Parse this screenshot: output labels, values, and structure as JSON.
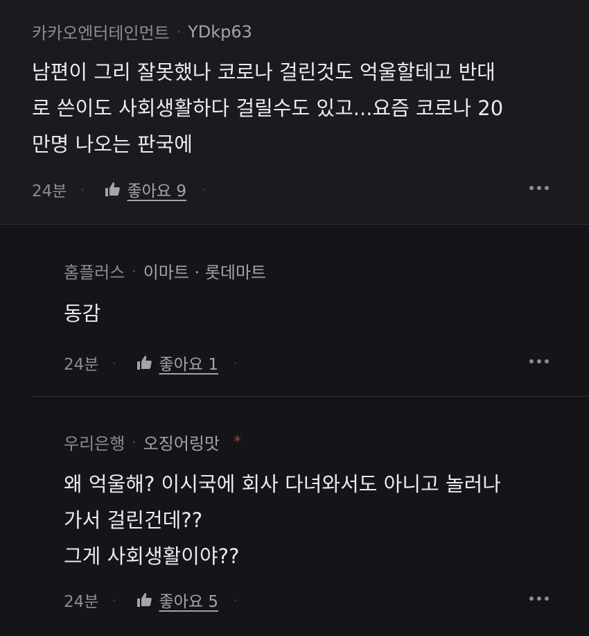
{
  "comments": [
    {
      "author_org": "카카오엔터테인먼트",
      "author_nick": "YDkp63",
      "body": "남편이 그리 잘못했나 코로나 걸린것도 억울할테고 반대\n로 쓴이도 사회생활하다 걸릴수도 있고...요즘 코로나 20\n만명 나오는 판국에",
      "time": "24분",
      "like_label": "좋아요 9"
    },
    {
      "author_org": "홈플러스",
      "author_nick": "이마트 · 롯데마트",
      "body": "동감",
      "time": "24분",
      "like_label": "좋아요 1"
    },
    {
      "author_org": "우리은행",
      "author_nick": "오징어링맛",
      "badge": "*",
      "body": "왜 억울해? 이시국에 회사 다녀와서도 아니고 놀러나\n가서 걸린건데??\n그게 사회생활이야??",
      "time": "24분",
      "like_label": "좋아요 5"
    }
  ],
  "meta_separator": "·",
  "colors": {
    "background": "#1b1a1f",
    "reply_background": "#151419",
    "badge": "#d0312d"
  },
  "icons": {
    "like": "thumbs-up-icon",
    "more": "more-horizontal-icon"
  }
}
